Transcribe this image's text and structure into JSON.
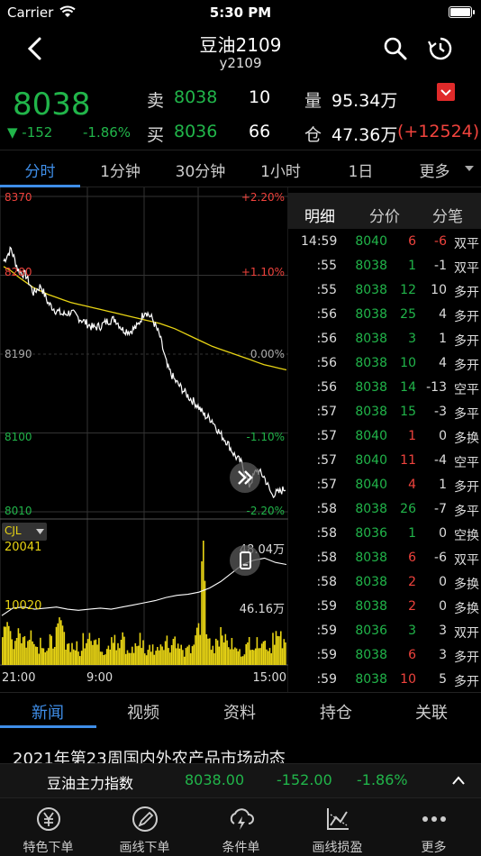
{
  "status_bar": {
    "carrier": "Carrier",
    "time": "5:30 PM"
  },
  "nav": {
    "title": "豆油2109",
    "subtitle": "y2109"
  },
  "quote": {
    "price": "8038",
    "change": "▼ -152",
    "change_pct": "-1.86%",
    "sell_label": "卖",
    "sell_price": "8038",
    "sell_qty": "10",
    "buy_label": "买",
    "buy_price": "8036",
    "buy_qty": "66",
    "volume_label": "量",
    "volume": "95.34万",
    "oi_label": "仓",
    "oi": "47.36万",
    "oi_change": "(+12524)"
  },
  "period_tabs": [
    "分时",
    "1分钟",
    "30分钟",
    "1小时",
    "1日",
    "更多"
  ],
  "chart": {
    "price_labels": [
      {
        "value": "8370",
        "pct": "+2.20%",
        "color": "#f0433d"
      },
      {
        "value": "8280",
        "pct": "+1.10%",
        "color": "#f0433d"
      },
      {
        "value": "8190",
        "pct": "0.00%",
        "color": "#aaaaaa"
      },
      {
        "value": "8100",
        "pct": "-1.10%",
        "color": "#21b54a"
      },
      {
        "value": "8010",
        "pct": "-2.20%",
        "color": "#21b54a"
      }
    ],
    "indicator": "CJL",
    "vol_max": "20041",
    "vol_mid": "10020",
    "oi_top": "48.04万",
    "oi_bottom": "46.16万",
    "time_labels": [
      "21:00",
      "9:00",
      "15:00"
    ]
  },
  "chart_data": {
    "type": "line",
    "ylim": [
      8010,
      8370
    ],
    "series": [],
    "price_path": [
      8296,
      8310,
      8285,
      8280,
      8260,
      8268,
      8248,
      8240,
      8235,
      8238,
      8232,
      8226,
      8220,
      8222,
      8228,
      8230,
      8218,
      8216,
      8222,
      8240,
      8230,
      8210,
      8175,
      8160,
      8150,
      8140,
      8132,
      8120,
      8115,
      8100,
      8090,
      8075,
      8065,
      8040,
      8058,
      8050,
      8030,
      8032,
      8038
    ],
    "avg_path": [
      8290,
      8285,
      8278,
      8272,
      8266,
      8262,
      8258,
      8255,
      8252,
      8249,
      8247,
      8245,
      8243,
      8241,
      8239,
      8237,
      8235,
      8233,
      8231,
      8229,
      8227,
      8225,
      8222,
      8219,
      8215,
      8211,
      8207,
      8203,
      8199,
      8196,
      8193,
      8190,
      8187,
      8184,
      8181,
      8178,
      8176,
      8174,
      8172
    ],
    "volume_bars": [
      0.35,
      0.25,
      0.2,
      0.3,
      0.22,
      0.18,
      0.28,
      0.15,
      0.2,
      0.12,
      0.18,
      0.24,
      0.3,
      0.2,
      0.16,
      0.14,
      0.1,
      0.22,
      0.3,
      0.2,
      0.16,
      0.12,
      0.18,
      0.26,
      0.14,
      0.2,
      0.1,
      0.12,
      0.16,
      0.2,
      0.1,
      0.14,
      0.12,
      0.18,
      0.2,
      0.16,
      0.22,
      0.14,
      0.1,
      0.12,
      0.18,
      0.26,
      0.92,
      0.2,
      0.14,
      0.22,
      0.3,
      0.18,
      0.16,
      0.12,
      0.1,
      0.14,
      0.2,
      0.16,
      0.22,
      0.18,
      0.14,
      0.26,
      0.2,
      0.16
    ],
    "oi_path": [
      0.38,
      0.45,
      0.46,
      0.44,
      0.45,
      0.46,
      0.44,
      0.43,
      0.44,
      0.45,
      0.44,
      0.46,
      0.48,
      0.5,
      0.52,
      0.55,
      0.57,
      0.58,
      0.6,
      0.64,
      0.7,
      0.78,
      0.86,
      0.9,
      0.92,
      0.88,
      0.86
    ]
  },
  "trade_panel": {
    "tabs": [
      "明细",
      "分价",
      "分笔"
    ],
    "rows": [
      {
        "time": "14:59",
        "price": "8040",
        "vol": "6",
        "oi": "-6",
        "type": "双平",
        "pc": "#21b54a",
        "vc": "#f0433d",
        "oc": "#f0433d",
        "tc": "#ddd"
      },
      {
        "time": ":55",
        "price": "8038",
        "vol": "1",
        "oi": "-1",
        "type": "双平",
        "pc": "#21b54a",
        "vc": "#21b54a",
        "oc": "#ddd",
        "tc": "#ddd"
      },
      {
        "time": ":55",
        "price": "8038",
        "vol": "12",
        "oi": "10",
        "type": "多开",
        "pc": "#21b54a",
        "vc": "#21b54a",
        "oc": "#ddd",
        "tc": "#ddd"
      },
      {
        "time": ":56",
        "price": "8038",
        "vol": "25",
        "oi": "4",
        "type": "多开",
        "pc": "#21b54a",
        "vc": "#21b54a",
        "oc": "#ddd",
        "tc": "#ddd"
      },
      {
        "time": ":56",
        "price": "8038",
        "vol": "3",
        "oi": "1",
        "type": "多开",
        "pc": "#21b54a",
        "vc": "#21b54a",
        "oc": "#ddd",
        "tc": "#ddd"
      },
      {
        "time": ":56",
        "price": "8038",
        "vol": "10",
        "oi": "4",
        "type": "多开",
        "pc": "#21b54a",
        "vc": "#21b54a",
        "oc": "#ddd",
        "tc": "#ddd"
      },
      {
        "time": ":56",
        "price": "8038",
        "vol": "14",
        "oi": "-13",
        "type": "空平",
        "pc": "#21b54a",
        "vc": "#21b54a",
        "oc": "#ddd",
        "tc": "#ddd"
      },
      {
        "time": ":57",
        "price": "8038",
        "vol": "15",
        "oi": "-3",
        "type": "多平",
        "pc": "#21b54a",
        "vc": "#21b54a",
        "oc": "#ddd",
        "tc": "#ddd"
      },
      {
        "time": ":57",
        "price": "8040",
        "vol": "1",
        "oi": "0",
        "type": "多换",
        "pc": "#21b54a",
        "vc": "#f0433d",
        "oc": "#ddd",
        "tc": "#ddd"
      },
      {
        "time": ":57",
        "price": "8040",
        "vol": "11",
        "oi": "-4",
        "type": "空平",
        "pc": "#21b54a",
        "vc": "#f0433d",
        "oc": "#ddd",
        "tc": "#ddd"
      },
      {
        "time": ":57",
        "price": "8040",
        "vol": "4",
        "oi": "1",
        "type": "多开",
        "pc": "#21b54a",
        "vc": "#f0433d",
        "oc": "#ddd",
        "tc": "#ddd"
      },
      {
        "time": ":58",
        "price": "8038",
        "vol": "26",
        "oi": "-7",
        "type": "多平",
        "pc": "#21b54a",
        "vc": "#21b54a",
        "oc": "#ddd",
        "tc": "#ddd"
      },
      {
        "time": ":58",
        "price": "8036",
        "vol": "1",
        "oi": "0",
        "type": "空换",
        "pc": "#21b54a",
        "vc": "#21b54a",
        "oc": "#ddd",
        "tc": "#ddd"
      },
      {
        "time": ":58",
        "price": "8038",
        "vol": "6",
        "oi": "-6",
        "type": "双平",
        "pc": "#21b54a",
        "vc": "#f0433d",
        "oc": "#ddd",
        "tc": "#ddd"
      },
      {
        "time": ":58",
        "price": "8038",
        "vol": "2",
        "oi": "0",
        "type": "多换",
        "pc": "#21b54a",
        "vc": "#f0433d",
        "oc": "#ddd",
        "tc": "#ddd"
      },
      {
        "time": ":59",
        "price": "8038",
        "vol": "2",
        "oi": "0",
        "type": "多换",
        "pc": "#21b54a",
        "vc": "#f0433d",
        "oc": "#ddd",
        "tc": "#ddd"
      },
      {
        "time": ":59",
        "price": "8036",
        "vol": "3",
        "oi": "3",
        "type": "双开",
        "pc": "#21b54a",
        "vc": "#21b54a",
        "oc": "#ddd",
        "tc": "#ddd"
      },
      {
        "time": ":59",
        "price": "8038",
        "vol": "6",
        "oi": "3",
        "type": "多开",
        "pc": "#21b54a",
        "vc": "#f0433d",
        "oc": "#ddd",
        "tc": "#ddd"
      },
      {
        "time": ":59",
        "price": "8038",
        "vol": "10",
        "oi": "5",
        "type": "多开",
        "pc": "#21b54a",
        "vc": "#f0433d",
        "oc": "#ddd",
        "tc": "#ddd"
      }
    ]
  },
  "news_tabs": [
    "新闻",
    "视频",
    "资料",
    "持仓",
    "关联"
  ],
  "headline": "2021年第23周国内外农产品市场动态",
  "index_bar": {
    "name": "豆油主力指数",
    "price": "8038.00",
    "change": "-152.00",
    "pct": "-1.86%",
    "expand": "⌃"
  },
  "toolbar": [
    {
      "label": "特色下单",
      "icon": "yen-order-icon"
    },
    {
      "label": "画线下单",
      "icon": "pen-draw-icon"
    },
    {
      "label": "条件单",
      "icon": "lightning-cloud-icon"
    },
    {
      "label": "画线损盈",
      "icon": "chart-line-icon"
    },
    {
      "label": "更多",
      "icon": "more-dots-icon"
    }
  ],
  "colors": {
    "accent": "#3f8ee8",
    "up": "#f0433d",
    "down": "#21b54a",
    "avg_line": "#e8d414"
  }
}
